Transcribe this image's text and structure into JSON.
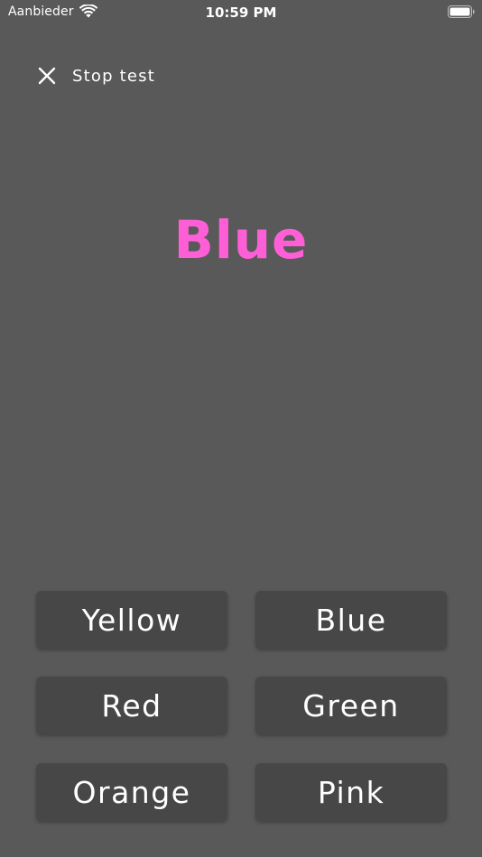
{
  "status_bar": {
    "carrier": "Aanbieder",
    "time": "10:59 PM",
    "icons": [
      "wifi-icon",
      "battery-icon"
    ]
  },
  "header": {
    "stop_label": "Stop test",
    "stop_icon": "close-icon"
  },
  "target": {
    "word": "Blue",
    "color": "#ff5fd6"
  },
  "answers": [
    {
      "label": "Yellow"
    },
    {
      "label": "Blue"
    },
    {
      "label": "Red"
    },
    {
      "label": "Green"
    },
    {
      "label": "Orange"
    },
    {
      "label": "Pink"
    }
  ],
  "colors": {
    "background": "#595959",
    "button": "#474747",
    "text": "#ffffff"
  }
}
